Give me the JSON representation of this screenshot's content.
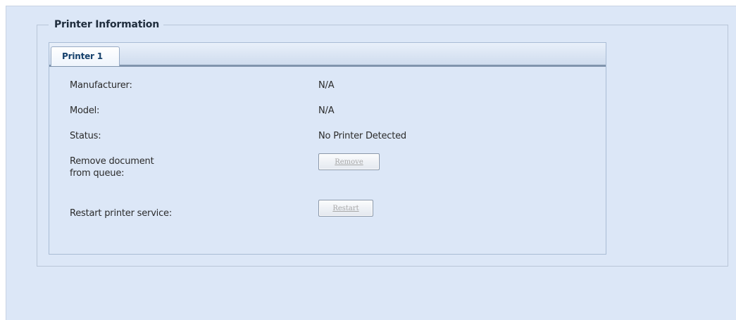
{
  "fieldset": {
    "legend": "Printer Information"
  },
  "tabs": [
    {
      "label": "Printer 1",
      "active": true
    }
  ],
  "rows": {
    "manufacturer": {
      "label": "Manufacturer:",
      "value": "N/A"
    },
    "model": {
      "label": "Model:",
      "value": "N/A"
    },
    "status": {
      "label": "Status:",
      "value": "No Printer Detected"
    },
    "remove": {
      "label_line1": "Remove document",
      "label_line2": "from queue:",
      "button": "Remove"
    },
    "restart": {
      "label": "Restart printer service:",
      "button": "Restart"
    }
  },
  "colors": {
    "background": "#dce7f7",
    "tab_text": "#15406b",
    "disabled_button_text": "#a8a8a8"
  }
}
